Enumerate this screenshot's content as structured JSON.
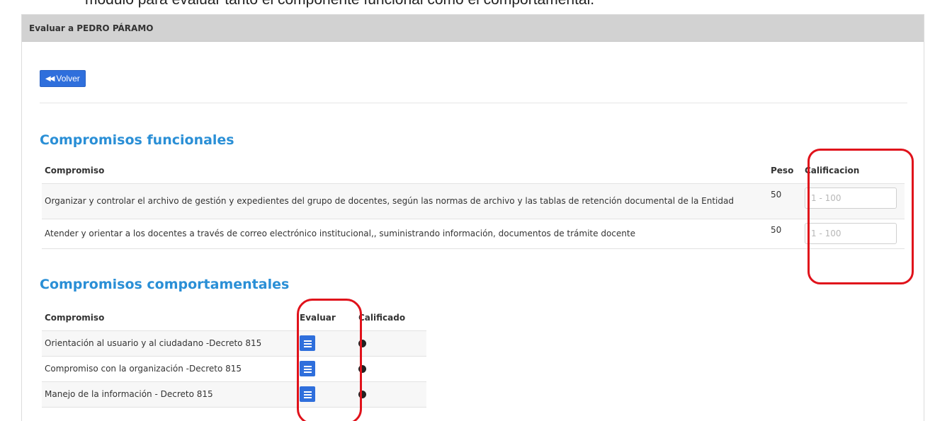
{
  "caption": "módulo para evaluar tanto el componente funcional como el comportamental.",
  "panel": {
    "title": "Evaluar a PEDRO PÁRAMO"
  },
  "back_button": {
    "label": "Volver",
    "icon": "double-left-arrow-icon"
  },
  "functional": {
    "title": "Compromisos funcionales",
    "headers": {
      "compromiso": "Compromiso",
      "peso": "Peso",
      "calificacion": "Calificacion"
    },
    "rows": [
      {
        "compromiso": "Organizar y controlar el archivo de gestión y expedientes del grupo de docentes, según las normas de archivo y las tablas de retención documental de la Entidad",
        "peso": "50",
        "placeholder": "1 - 100"
      },
      {
        "compromiso": "Atender y orientar a los docentes a través de correo electrónico institucional,, suministrando información, documentos de trámite docente",
        "peso": "50",
        "placeholder": "1 - 100"
      }
    ]
  },
  "behavioral": {
    "title": "Compromisos comportamentales",
    "headers": {
      "compromiso": "Compromiso",
      "evaluar": "Evaluar",
      "calificado": "Calificado"
    },
    "rows": [
      {
        "compromiso": "Orientación al usuario y al ciudadano -Decreto 815",
        "evaluar_icon": "list-check-icon",
        "calificado_icon": "status-dot-icon"
      },
      {
        "compromiso": "Compromiso con la organización -Decreto 815",
        "evaluar_icon": "list-check-icon",
        "calificado_icon": "status-dot-icon"
      },
      {
        "compromiso": "Manejo de la información - Decreto 815",
        "evaluar_icon": "list-check-icon",
        "calificado_icon": "status-dot-icon"
      }
    ]
  },
  "colors": {
    "accent": "#2f6fdc",
    "section_title": "#2a8fd6",
    "header_bg": "#d2d2d2",
    "annotation": "#e0121b"
  }
}
